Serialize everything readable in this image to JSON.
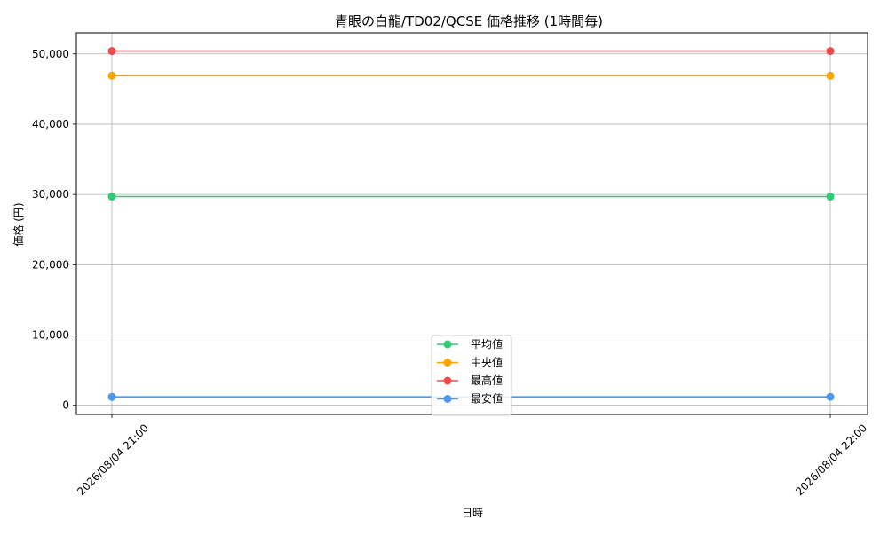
{
  "chart_data": {
    "type": "line",
    "title": "青眼の白龍/TD02/QCSE 価格推移 (1時間毎)",
    "xlabel": "日時",
    "ylabel": "価格 (円)",
    "x": [
      "2026/08/04 21:00",
      "2026/08/04 22:00"
    ],
    "ylim": [
      -1300,
      53000
    ],
    "yticks": [
      0,
      10000,
      20000,
      30000,
      40000,
      50000
    ],
    "ytick_labels": [
      "0",
      "10,000",
      "20,000",
      "30,000",
      "40,000",
      "50,000"
    ],
    "grid": true,
    "legend_position": "lower-center",
    "series": [
      {
        "name": "平均値",
        "color": "#2ecc71",
        "values": [
          29700,
          29700
        ]
      },
      {
        "name": "中央値",
        "color": "#ffa500",
        "values": [
          46900,
          46900
        ]
      },
      {
        "name": "最高値",
        "color": "#ef4b4b",
        "values": [
          50400,
          50400
        ]
      },
      {
        "name": "最安値",
        "color": "#4a98f0",
        "values": [
          1200,
          1200
        ]
      }
    ]
  }
}
